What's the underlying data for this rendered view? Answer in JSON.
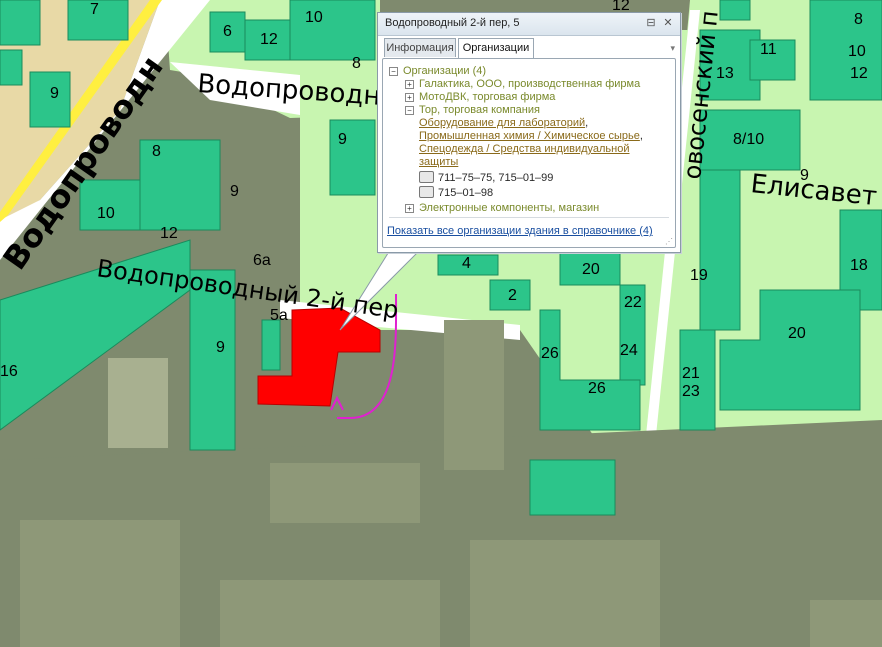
{
  "map": {
    "streets": [
      {
        "text": "Водопроводн"
      },
      {
        "text": "Водопроводн"
      },
      {
        "text": "Водопроводный 2-й пер"
      },
      {
        "text": "Елисавет"
      },
      {
        "text": "овосенский п"
      }
    ],
    "building_numbers": [
      "7",
      "9",
      "6",
      "12",
      "10",
      "8",
      "12",
      "9",
      "8",
      "10",
      "12",
      "9",
      "6а",
      "5а",
      "9",
      "16",
      "4",
      "2",
      "20",
      "22",
      "24",
      "26",
      "26",
      "13",
      "11",
      "8",
      "10",
      "12",
      "8/10",
      "9",
      "19",
      "18",
      "20",
      "21",
      "23"
    ],
    "colors": {
      "ground": "#7f8a6e",
      "block_light": "#c8f5b0",
      "building": "#2cc58a",
      "building_top": "#3ddf9e",
      "selected_building": "#ff0000",
      "route_arrow": "#e020d0",
      "road": "#ffffff"
    }
  },
  "popup": {
    "title": "Водопроводный 2-й пер, 5",
    "pin_icon": "pin-icon",
    "close_icon": "close-icon",
    "tabs": [
      {
        "label": "Информация",
        "active": false
      },
      {
        "label": "Организации",
        "active": true
      }
    ],
    "tree": {
      "root_label": "Организации (4)",
      "items": [
        {
          "label": "Галактика, ООО, производственная фирма",
          "expanded": false
        },
        {
          "label": "МотоДВК, торговая фирма",
          "expanded": false
        },
        {
          "label": "Тор, торговая компания",
          "expanded": true,
          "links": [
            "Оборудование для лабораторий",
            "Промышленная химия / Химическое сырье",
            "Спецодежда / Средства индивидуальной защиты"
          ],
          "phones": [
            "711–75–75, 715–01–99"
          ],
          "faxes": [
            "715–01–98"
          ]
        },
        {
          "label": "Электронные компоненты, магазин",
          "expanded": false
        }
      ]
    },
    "footer": {
      "link": "Показать все организации здания в справочнике",
      "count": "(4)"
    }
  }
}
